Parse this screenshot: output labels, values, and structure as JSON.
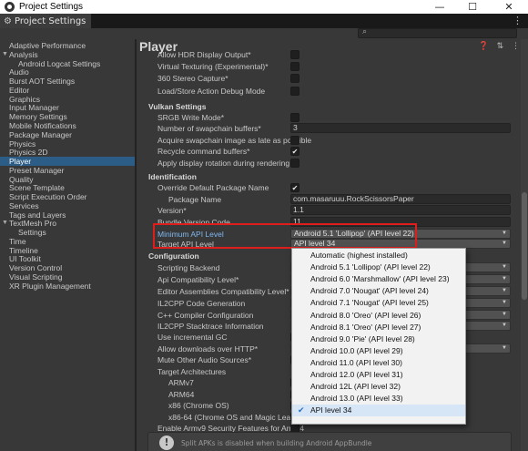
{
  "window": {
    "title": "Project Settings",
    "minimize": "—",
    "maximize": "☐",
    "close": "✕"
  },
  "tab": {
    "label": "Project Settings",
    "menu": "⋮"
  },
  "sidebar": [
    {
      "label": "Adaptive Performance"
    },
    {
      "label": "Analysis",
      "expanded": true
    },
    {
      "label": "Android Logcat Settings",
      "sub": true
    },
    {
      "label": "Audio"
    },
    {
      "label": "Burst AOT Settings"
    },
    {
      "label": "Editor"
    },
    {
      "label": "Graphics"
    },
    {
      "label": "Input Manager"
    },
    {
      "label": "Memory Settings"
    },
    {
      "label": "Mobile Notifications"
    },
    {
      "label": "Package Manager"
    },
    {
      "label": "Physics"
    },
    {
      "label": "Physics 2D"
    },
    {
      "label": "Player",
      "selected": true
    },
    {
      "label": "Preset Manager"
    },
    {
      "label": "Quality"
    },
    {
      "label": "Scene Template"
    },
    {
      "label": "Script Execution Order"
    },
    {
      "label": "Services"
    },
    {
      "label": "Tags and Layers"
    },
    {
      "label": "TextMesh Pro",
      "expanded": true
    },
    {
      "label": "Settings",
      "sub": true
    },
    {
      "label": "Time"
    },
    {
      "label": "Timeline"
    },
    {
      "label": "UI Toolkit"
    },
    {
      "label": "Version Control"
    },
    {
      "label": "Visual Scripting"
    },
    {
      "label": "XR Plugin Management"
    }
  ],
  "main": {
    "title": "Player",
    "header_icons": "❓ ⇅ ⋮",
    "rows": [
      {
        "label": "Allow HDR Display Output*",
        "kind": "checkbox",
        "checked": false
      },
      {
        "label": "Virtual Texturing (Experimental)*",
        "kind": "checkbox",
        "checked": false
      },
      {
        "label": "",
        "kind": "spacer"
      },
      {
        "label": "360 Stereo Capture*",
        "kind": "checkbox",
        "checked": false
      },
      {
        "label": "Load/Store Action Debug Mode",
        "kind": "checkbox",
        "checked": false
      },
      {
        "label": "",
        "kind": "spacer"
      },
      {
        "label": "Vulkan Settings",
        "kind": "header"
      },
      {
        "label": "SRGB Write Mode*",
        "kind": "checkbox",
        "checked": false
      },
      {
        "label": "Number of swapchain buffers*",
        "kind": "text",
        "value": "3"
      },
      {
        "label": "Acquire swapchain image as late as possible",
        "kind": "checkbox",
        "checked": false
      },
      {
        "label": "Recycle command buffers*",
        "kind": "checkbox",
        "checked": true
      },
      {
        "label": "Apply display rotation during rendering",
        "kind": "checkbox",
        "checked": false
      },
      {
        "label": "",
        "kind": "spacer"
      },
      {
        "label": "Identification",
        "kind": "header"
      },
      {
        "label": "Override Default Package Name",
        "kind": "checkbox",
        "checked": true
      },
      {
        "label": "Package Name",
        "kind": "text",
        "value": "com.masaruuu.RockScissorsPaper",
        "indent": true
      },
      {
        "label": "Version*",
        "kind": "text",
        "value": "1.1"
      },
      {
        "label": "Bundle Version Code",
        "kind": "text",
        "value": "11"
      },
      {
        "label": "Minimum API Level",
        "kind": "dropdown",
        "value": "Android 5.1 'Lollipop' (API level 22)",
        "blue": true
      },
      {
        "label": "Target API Level",
        "kind": "dropdown",
        "value": "API level 34"
      },
      {
        "label": "",
        "kind": "spacer"
      },
      {
        "label": "Configuration",
        "kind": "header"
      },
      {
        "label": "Scripting Backend",
        "kind": "dropdown",
        "value": ""
      },
      {
        "label": "Api Compatibility Level*",
        "kind": "dropdown",
        "value": ""
      },
      {
        "label": "Editor Assemblies Compatibility Level*",
        "kind": "dropdown",
        "value": ""
      },
      {
        "label": "IL2CPP Code Generation",
        "kind": "dropdown",
        "value": ""
      },
      {
        "label": "C++ Compiler Configuration",
        "kind": "dropdown",
        "value": ""
      },
      {
        "label": "IL2CPP Stacktrace Information",
        "kind": "dropdown",
        "value": ""
      },
      {
        "label": "Use incremental GC",
        "kind": "checkbox",
        "checked": false
      },
      {
        "label": "Allow downloads over HTTP*",
        "kind": "dropdown",
        "value": ""
      },
      {
        "label": "Mute Other Audio Sources*",
        "kind": "checkbox",
        "checked": false
      },
      {
        "label": "Target Architectures",
        "kind": "label"
      },
      {
        "label": "ARMv7",
        "kind": "checkbox",
        "checked": false,
        "indent2": true
      },
      {
        "label": "ARM64",
        "kind": "checkbox",
        "checked": false,
        "indent2": true
      },
      {
        "label": "x86 (Chrome OS)",
        "kind": "checkbox",
        "checked": false,
        "indent2": true
      },
      {
        "label": "x86-64 (Chrome OS and Magic Leap 2)",
        "kind": "checkbox",
        "checked": false,
        "indent2": true
      },
      {
        "label": "Enable Armv9 Security Features for Arm64",
        "kind": "checkbox",
        "checked": false
      }
    ],
    "help_text": "Split APKs is disabled when building Android AppBundle"
  },
  "popup": {
    "options": [
      {
        "label": "Automatic (highest installed)"
      },
      {
        "label": "Android 5.1 'Lollipop' (API level 22)"
      },
      {
        "label": "Android 6.0 'Marshmallow' (API level 23)"
      },
      {
        "label": "Android 7.0 'Nougat' (API level 24)"
      },
      {
        "label": "Android 7.1 'Nougat' (API level 25)"
      },
      {
        "label": "Android 8.0 'Oreo' (API level 26)"
      },
      {
        "label": "Android 8.1 'Oreo' (API level 27)"
      },
      {
        "label": "Android 9.0 'Pie' (API level 28)"
      },
      {
        "label": "Android 10.0 (API level 29)"
      },
      {
        "label": "Android 11.0 (API level 30)"
      },
      {
        "label": "Android 12.0 (API level 31)"
      },
      {
        "label": "Android 12L (API level 32)"
      },
      {
        "label": "Android 13.0 (API level 33)"
      },
      {
        "label": "API level 34",
        "selected": true
      }
    ]
  },
  "colors": {
    "highlight": "#e01d1d",
    "selection": "#2c5d87",
    "link_blue": "#7fb8f0"
  }
}
